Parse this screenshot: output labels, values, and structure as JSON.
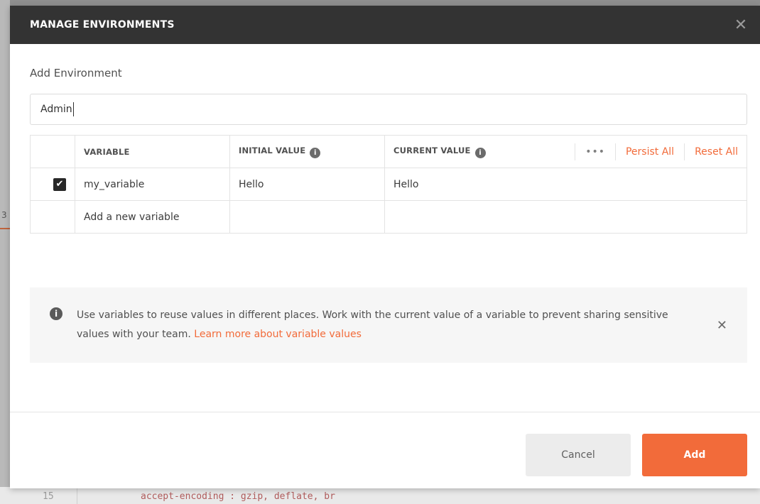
{
  "modal": {
    "title": "MANAGE ENVIRONMENTS",
    "close_glyph": "✕"
  },
  "form": {
    "section_title": "Add Environment",
    "env_name_value": "Admin"
  },
  "table": {
    "headers": {
      "variable": "VARIABLE",
      "initial_value": "INITIAL VALUE",
      "current_value": "CURRENT VALUE",
      "more": "•••",
      "persist_all": "Persist All",
      "reset_all": "Reset All"
    },
    "rows": [
      {
        "checked": true,
        "variable": "my_variable",
        "initial_value": "Hello",
        "current_value": "Hello"
      }
    ],
    "new_row_placeholder": "Add a new variable"
  },
  "banner": {
    "text": "Use variables to reuse values in different places. Work with the current value of a variable to prevent sharing sensitive values with your team.",
    "link": "Learn more about variable values"
  },
  "footer": {
    "cancel_label": "Cancel",
    "add_label": "Add"
  },
  "background": {
    "line_number": "15",
    "code": "accept-encoding : gzip, deflate, br"
  },
  "colors": {
    "accent": "#f26b3a",
    "header_bg": "#333333"
  }
}
